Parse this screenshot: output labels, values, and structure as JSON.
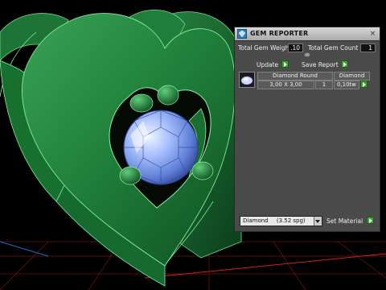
{
  "panel": {
    "title": "GEM REPORTER",
    "close_glyph": "×",
    "total_gem_weight_label": "Total Gem Weight",
    "total_gem_weight_value": ".10",
    "total_gem_count_label": "Total Gem Count",
    "total_gem_count_value": "1",
    "update_label": "Update",
    "save_report_label": "Save Report",
    "gem_row": {
      "shape": "Diamond Round",
      "size": "3,00 X 3,00",
      "material": "Diamond",
      "count": "1",
      "weight": "0,10tw"
    },
    "material_select_value": "Diamond",
    "material_select_detail": "(3.52 spg)",
    "set_material_label": "Set Material"
  },
  "colors": {
    "model_green": "#1f7a35",
    "gem_blue": "#8fb0ff",
    "button_green": "#3aa02f",
    "panel_bg": "#4a4a4a"
  },
  "icons": {
    "app": "gem-reporter-app-icon",
    "close": "close-icon",
    "arrow": "green-arrow-icon",
    "dropdown": "chevron-down-icon",
    "thumbnail": "round-diamond-thumbnail-icon"
  }
}
